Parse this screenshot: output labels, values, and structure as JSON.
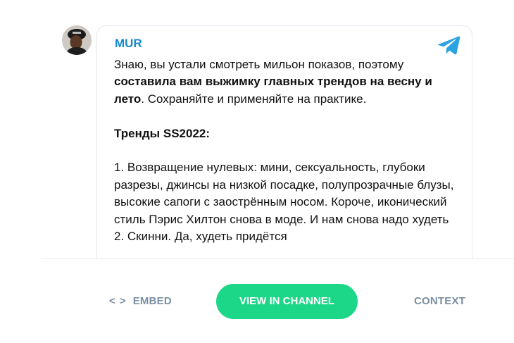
{
  "post": {
    "channel_name": "MUR",
    "avatar_icon": "channel-avatar-photo",
    "telegram_icon": "telegram-plane-icon",
    "intro_plain": "Знаю, вы устали смотреть мильон показов, поэтому ",
    "intro_bold": "составила вам выжимку главных трендов на весну и лето",
    "intro_tail": ". Сохраняйте и применяйте на практике.",
    "trends_heading": "Тренды SS2022:",
    "trend_1": "1. Возвращение нулевых: мини, сексуальность, глубоки разрезы, джинсы на низкой посадке, полупрозрачные блузы, высокие сапоги с заострённым носом. Короче, иконический стиль Пэрис Хилтон снова в моде. И нам снова надо худеть",
    "trend_2": "2. Скинни. Да, худеть придётся"
  },
  "footer": {
    "embed_icon": "< >",
    "embed_label": "EMBED",
    "view_label": "VIEW IN CHANNEL",
    "context_label": "CONTEXT"
  },
  "colors": {
    "channel_name": "#168acd",
    "telegram_blue": "#2aa3e0",
    "button_green": "#1cd787",
    "footer_link": "#7a8ea3",
    "card_border": "#e3e8ee"
  }
}
